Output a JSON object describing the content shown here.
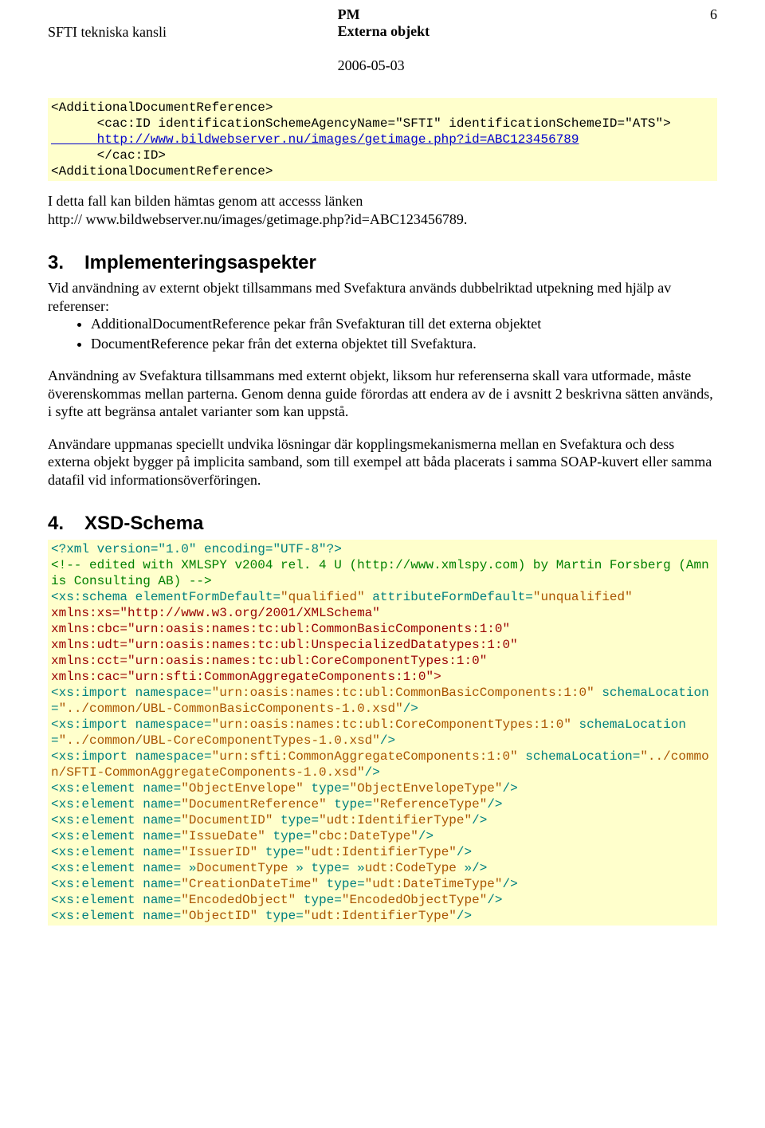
{
  "header": {
    "left": "SFTI tekniska kansli",
    "center_line1": "PM",
    "center_line2": "Externa objekt",
    "page_number": "6",
    "date": "2006-05-03"
  },
  "code1": {
    "l1": "<AdditionalDocumentReference>",
    "l2_pre": "      <cac:ID identificationSchemeAgencyName=\"SFTI\" identificationSchemeID=\"ATS\">",
    "l3_link": "      http://www.bildwebserver.nu/images/getimage.php?id=ABC123456789",
    "l4": "      </cac:ID>",
    "l5": "<AdditionalDocumentReference>"
  },
  "para1": {
    "text": "I detta fall kan bilden hämtas genom att accesss länken",
    "link": "http:// www.bildwebserver.nu/images/getimage.php?id=ABC123456789."
  },
  "sec3": {
    "num": "3.",
    "title": "Implementeringsaspekter",
    "intro": "Vid användning av externt objekt tillsammans med Svefaktura används dubbelriktad utpekning med hjälp av referenser:",
    "bullet1": "AdditionalDocumentReference pekar från Svefakturan till det externa objektet",
    "bullet2": "DocumentReference pekar från det externa objektet till Svefaktura.",
    "p2": "Användning av Svefaktura tillsammans med externt objekt, liksom hur referenserna skall vara utformade, måste överenskommas mellan parterna. Genom denna guide förordas att endera av de i avsnitt 2 beskrivna sätten används, i syfte att begränsa antalet varianter som kan uppstå.",
    "p3": "Användare uppmanas speciellt undvika lösningar där kopplingsmekanismerna mellan en Svefaktura och dess externa objekt bygger på implicita samband, som till exempel att båda placerats i samma SOAP-kuvert eller samma datafil vid informationsöverföringen."
  },
  "sec4": {
    "num": "4.",
    "title": "XSD-Schema"
  },
  "code2": {
    "l1": "<?xml version=\"1.0\" encoding=\"UTF-8\"?>",
    "l2": "<!-- edited with XMLSPY v2004 rel. 4 U (http://www.xmlspy.com) by Martin Forsberg (Amnis Consulting AB) -->",
    "l3a": "<xs:schema elementFormDefault=",
    "l3b": "\"qualified\"",
    "l3c": " attributeFormDefault=",
    "l3d": "\"unqualified\"",
    "l4": "xmlns:xs=\"http://www.w3.org/2001/XMLSchema\"",
    "l5": "xmlns:cbc=\"urn:oasis:names:tc:ubl:CommonBasicComponents:1:0\"",
    "l6": "xmlns:udt=\"urn:oasis:names:tc:ubl:UnspecializedDatatypes:1:0\"",
    "l7": "xmlns:cct=\"urn:oasis:names:tc:ubl:CoreComponentTypes:1:0\"",
    "l8": "xmlns:cac=\"urn:sfti:CommonAggregateComponents:1:0\">",
    "l9a": "<xs:import namespace=",
    "l9b": "\"urn:oasis:names:tc:ubl:CommonBasicComponents:1:0\"",
    "l9c": " schemaLocation=",
    "l9d": "\"../common/UBL-CommonBasicComponents-1.0.xsd\"",
    "l9e": "/>",
    "l10a": "<xs:import namespace=",
    "l10b": "\"urn:oasis:names:tc:ubl:CoreComponentTypes:1:0\"",
    "l10c": " schemaLocation=",
    "l10d": "\"../common/UBL-CoreComponentTypes-1.0.xsd\"",
    "l10e": "/>",
    "l11a": "<xs:import namespace=",
    "l11b": "\"urn:sfti:CommonAggregateComponents:1:0\"",
    "l11c": " schemaLocation=",
    "l11d": "\"../common/SFTI-CommonAggregateComponents-1.0.xsd\"",
    "l11e": "/>",
    "l12a": "<xs:element name=",
    "l12b": "\"ObjectEnvelope\"",
    "l12c": " type=",
    "l12d": "\"ObjectEnvelopeType\"",
    "l12e": "/>",
    "l13a": "<xs:element name=",
    "l13b": "\"DocumentReference\"",
    "l13c": " type=",
    "l13d": "\"ReferenceType\"",
    "l13e": "/>",
    "l14a": "<xs:element name=",
    "l14b": "\"DocumentID\"",
    "l14c": " type=",
    "l14d": "\"udt:IdentifierType\"",
    "l14e": "/>",
    "l15a": "<xs:element name=",
    "l15b": "\"IssueDate\"",
    "l15c": " type=",
    "l15d": "\"cbc:DateType\"",
    "l15e": "/>",
    "l16a": "<xs:element name=",
    "l16b": "\"IssuerID\"",
    "l16c": " type=",
    "l16d": "\"udt:IdentifierType\"",
    "l16e": "/>",
    "l17a": "<xs:element name= »",
    "l17b": "DocumentType ",
    "l17c": "» type= »",
    "l17d": "udt:CodeType ",
    "l17e": "»/>",
    "l18a": "<xs:element name=",
    "l18b": "\"CreationDateTime\"",
    "l18c": " type=",
    "l18d": "\"udt:DateTimeType\"",
    "l18e": "/>",
    "l19a": "<xs:element name=",
    "l19b": "\"EncodedObject\"",
    "l19c": " type=",
    "l19d": "\"EncodedObjectType\"",
    "l19e": "/>",
    "l20a": "<xs:element name=",
    "l20b": "\"ObjectID\"",
    "l20c": " type=",
    "l20d": "\"udt:IdentifierType\"",
    "l20e": "/>"
  }
}
